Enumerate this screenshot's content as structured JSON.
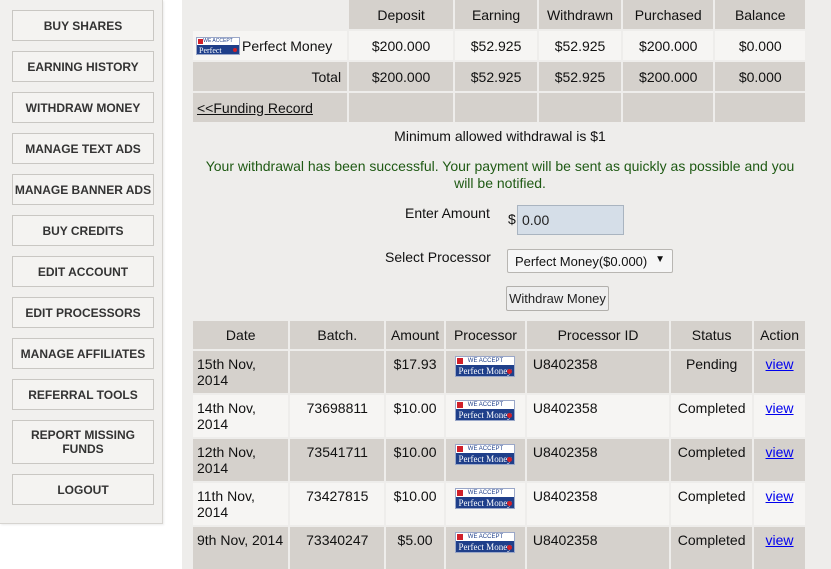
{
  "sidebar": {
    "items": [
      {
        "label": "BUY SHARES"
      },
      {
        "label": "EARNING HISTORY"
      },
      {
        "label": "WITHDRAW MONEY"
      },
      {
        "label": "MANAGE TEXT ADS"
      },
      {
        "label": "MANAGE BANNER ADS"
      },
      {
        "label": "BUY CREDITS"
      },
      {
        "label": "EDIT ACCOUNT"
      },
      {
        "label": "EDIT PROCESSORS"
      },
      {
        "label": "MANAGE AFFILIATES"
      },
      {
        "label": "REFERRAL TOOLS"
      },
      {
        "label": "REPORT MISSING FUNDS"
      },
      {
        "label": "LOGOUT"
      }
    ]
  },
  "logo": {
    "top_text": "WE ACCEPT",
    "bottom_text": "Perfect Money"
  },
  "balance_table": {
    "headers": [
      "Deposit",
      "Earning",
      "Withdrawn",
      "Purchased",
      "Balance"
    ],
    "rows": [
      {
        "processor": "Perfect Money",
        "deposit": "$200.000",
        "earning": "$52.925",
        "withdrawn": "$52.925",
        "purchased": "$200.000",
        "balance": "$0.000"
      }
    ],
    "total": {
      "label": "Total",
      "deposit": "$200.000",
      "earning": "$52.925",
      "withdrawn": "$52.925",
      "purchased": "$200.000",
      "balance": "$0.000"
    },
    "funding_link": "<<Funding Record"
  },
  "messages": {
    "minimum": "Minimum allowed withdrawal is $1",
    "success": "Your withdrawal has been successful. Your payment will be sent as quickly as possible and you will be notified."
  },
  "form": {
    "amount_label": "Enter Amount",
    "currency_symbol": "$",
    "amount_value": "0.00",
    "processor_label": "Select Processor",
    "processor_selected": "Perfect Money($0.000)",
    "submit_label": "Withdraw Money"
  },
  "history": {
    "headers": [
      "Date",
      "Batch.",
      "Amount",
      "Processor",
      "Processor ID",
      "Status",
      "Action"
    ],
    "rows": [
      {
        "date": "15th Nov, 2014",
        "batch": "",
        "amount": "$17.93",
        "processor_id": "U8402358",
        "status": "Pending",
        "action": "view"
      },
      {
        "date": "14th Nov, 2014",
        "batch": "73698811",
        "amount": "$10.00",
        "processor_id": "U8402358",
        "status": "Completed",
        "action": "view"
      },
      {
        "date": "12th Nov, 2014",
        "batch": "73541711",
        "amount": "$10.00",
        "processor_id": "U8402358",
        "status": "Completed",
        "action": "view"
      },
      {
        "date": "11th Nov, 2014",
        "batch": "73427815",
        "amount": "$10.00",
        "processor_id": "U8402358",
        "status": "Completed",
        "action": "view"
      },
      {
        "date": "9th Nov, 2014",
        "batch": "73340247",
        "amount": "$5.00",
        "processor_id": "U8402358",
        "status": "Completed",
        "action": "view"
      }
    ]
  },
  "colors": {
    "header_bg": "#d5d1cc",
    "success_text": "#1f5a14",
    "link": "#0000ee",
    "visited_link": "#4b2c8a",
    "input_bg": "#d5dee8"
  }
}
